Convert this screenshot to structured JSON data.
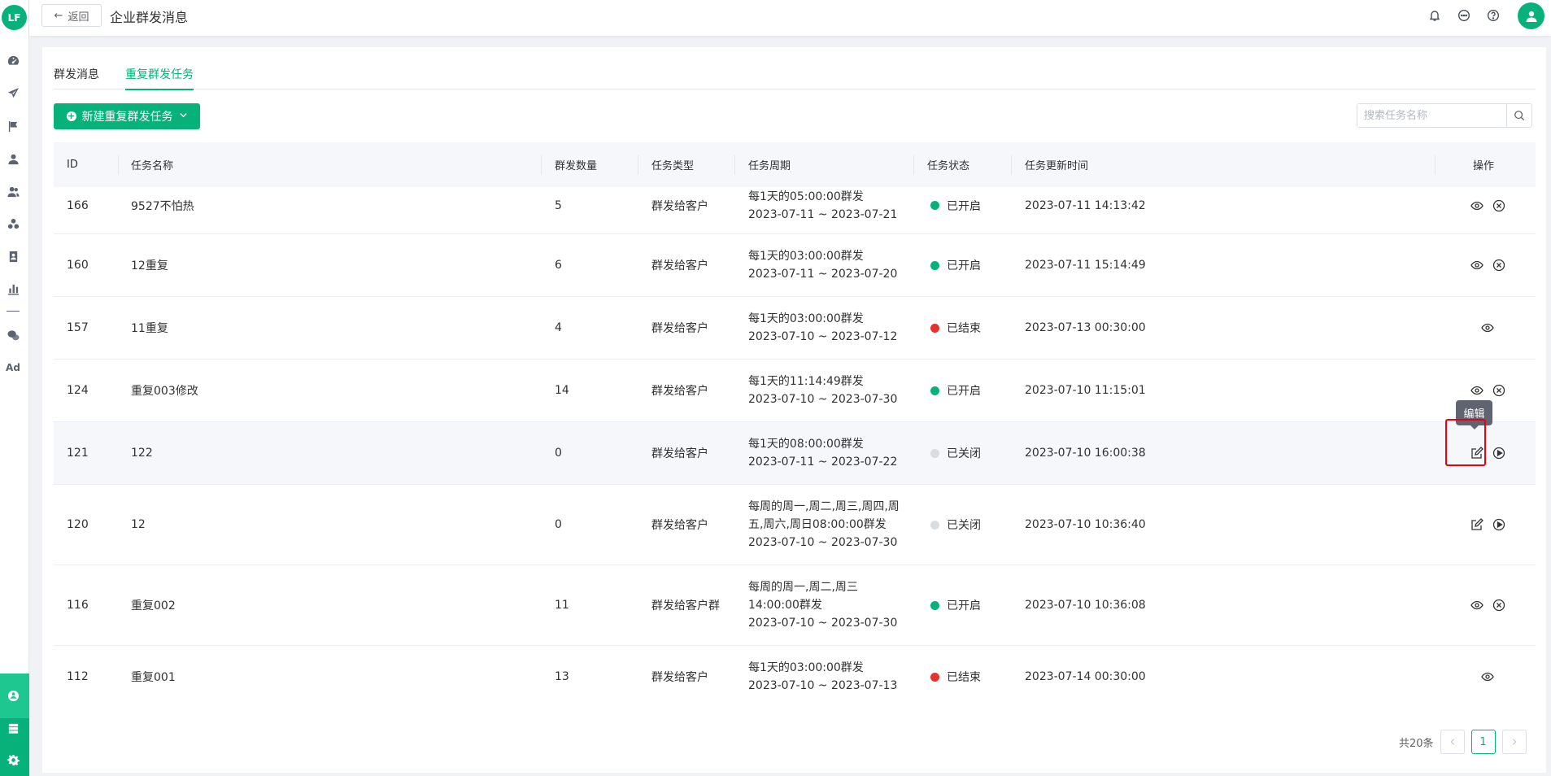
{
  "sidebar": {
    "logo_text": "LF",
    "items": [
      "dashboard-icon",
      "send-icon",
      "flag-icon",
      "user-icon",
      "users-icon",
      "group-icon",
      "contact-book-icon",
      "bar-chart-icon",
      "wechat-icon"
    ],
    "ad_label": "Ad",
    "bottom": [
      "chat-group-icon",
      "storage-icon",
      "gear-icon"
    ]
  },
  "header": {
    "back_label": "返回",
    "title": "企业群发消息"
  },
  "tabs": [
    "群发消息",
    "重复群发任务"
  ],
  "toolbar": {
    "new_label": "新建重复群发任务",
    "search_placeholder": "搜索任务名称"
  },
  "table": {
    "columns": [
      "ID",
      "任务名称",
      "群发数量",
      "任务类型",
      "任务周期",
      "任务状态",
      "任务更新时间",
      "操作"
    ],
    "rows": [
      {
        "id": "166",
        "name": "9527不怕热",
        "count": "5",
        "type": "群发给客户",
        "period": [
          "每1天的05:00:00群发",
          "2023-07-11 ~ 2023-07-21"
        ],
        "status": "已开启",
        "status_color": "#07b27a",
        "updated": "2023-07-11 14:13:42",
        "ops": [
          "eye",
          "close"
        ]
      },
      {
        "id": "160",
        "name": "12重复",
        "count": "6",
        "type": "群发给客户",
        "period": [
          "每1天的03:00:00群发",
          "2023-07-11 ~ 2023-07-20"
        ],
        "status": "已开启",
        "status_color": "#07b27a",
        "updated": "2023-07-11 15:14:49",
        "ops": [
          "eye",
          "close"
        ]
      },
      {
        "id": "157",
        "name": "11重复",
        "count": "4",
        "type": "群发给客户",
        "period": [
          "每1天的03:00:00群发",
          "2023-07-10 ~ 2023-07-12"
        ],
        "status": "已结束",
        "status_color": "#e8302e",
        "updated": "2023-07-13 00:30:00",
        "ops": [
          "eye"
        ]
      },
      {
        "id": "124",
        "name": "重复003修改",
        "count": "14",
        "type": "群发给客户",
        "period": [
          "每1天的11:14:49群发",
          "2023-07-10 ~ 2023-07-30"
        ],
        "status": "已开启",
        "status_color": "#07b27a",
        "updated": "2023-07-10 11:15:01",
        "ops": [
          "eye",
          "close"
        ]
      },
      {
        "id": "121",
        "name": "122",
        "count": "0",
        "type": "群发给客户",
        "period": [
          "每1天的08:00:00群发",
          "2023-07-11 ~ 2023-07-22"
        ],
        "status": "已关闭",
        "status_color": "#d9dce1",
        "updated": "2023-07-10 16:00:38",
        "ops": [
          "edit",
          "play"
        ]
      },
      {
        "id": "120",
        "name": "12",
        "count": "0",
        "type": "群发给客户",
        "period": [
          "每周的周一,周二,周三,周四,周",
          "五,周六,周日08:00:00群发",
          "2023-07-10 ~ 2023-07-30"
        ],
        "status": "已关闭",
        "status_color": "#d9dce1",
        "updated": "2023-07-10 10:36:40",
        "ops": [
          "edit",
          "play"
        ]
      },
      {
        "id": "116",
        "name": "重复002",
        "count": "11",
        "type": "群发给客户群",
        "period": [
          "每周的周一,周二,周三",
          "14:00:00群发",
          "2023-07-10 ~ 2023-07-30"
        ],
        "status": "已开启",
        "status_color": "#07b27a",
        "updated": "2023-07-10 10:36:08",
        "ops": [
          "eye",
          "close"
        ]
      },
      {
        "id": "112",
        "name": "重复001",
        "count": "13",
        "type": "群发给客户",
        "period": [
          "每1天的03:00:00群发",
          "2023-07-10 ~ 2023-07-13"
        ],
        "status": "已结束",
        "status_color": "#e8302e",
        "updated": "2023-07-14 00:30:00",
        "ops": [
          "eye"
        ]
      }
    ]
  },
  "tooltip": "编辑",
  "pagination": {
    "total_label": "共20条",
    "current_page": "1"
  }
}
